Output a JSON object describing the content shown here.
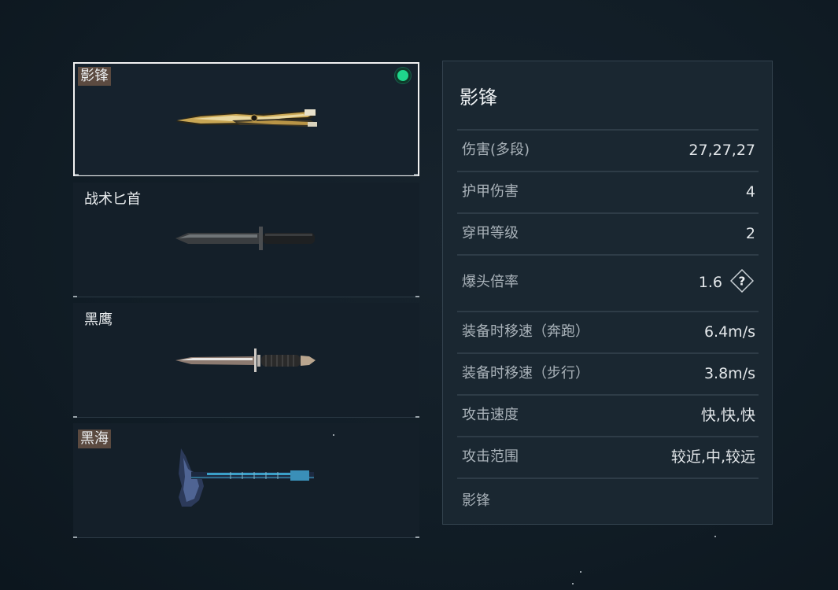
{
  "weapons": [
    {
      "name": "影锋",
      "selected": true,
      "equipped": true,
      "has_tag": true
    },
    {
      "name": "战术匕首",
      "selected": false,
      "equipped": false,
      "has_tag": false
    },
    {
      "name": "黑鹰",
      "selected": false,
      "equipped": false,
      "has_tag": false
    },
    {
      "name": "黑海",
      "selected": false,
      "equipped": false,
      "has_tag": true
    }
  ],
  "detail": {
    "title": "影锋",
    "stats": [
      {
        "label": "伤害(多段)",
        "value": "27,27,27"
      },
      {
        "label": "护甲伤害",
        "value": "4"
      },
      {
        "label": "穿甲等级",
        "value": "2"
      },
      {
        "label": "爆头倍率",
        "value": "1.6",
        "help": "?"
      },
      {
        "label": "装备时移速（奔跑）",
        "value": "6.4m/s"
      },
      {
        "label": "装备时移速（步行）",
        "value": "3.8m/s"
      },
      {
        "label": "攻击速度",
        "value": "快,快,快"
      },
      {
        "label": "攻击范围",
        "value": "较近,中,较远"
      }
    ],
    "footer": "影锋"
  },
  "colors": {
    "equipped": "#1fd68c",
    "name_tag": "#5b4a40",
    "selected_border": "#f2f2f2"
  }
}
